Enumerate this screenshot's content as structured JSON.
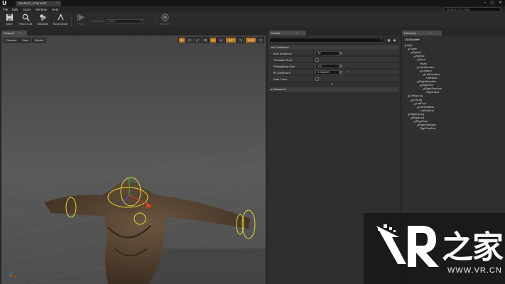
{
  "window": {
    "logo": "U",
    "doc_tab": "Skeleton_Character",
    "controls": [
      "–",
      "▢",
      "✕"
    ]
  },
  "menu": {
    "items": [
      "File",
      "Edit",
      "Asset",
      "Window",
      "Help"
    ],
    "search_placeholder": "Search For Help"
  },
  "toolbar": {
    "buttons": [
      {
        "label": "Save",
        "icon": "save-icon"
      },
      {
        "label": "Find in CB",
        "icon": "find-in-browser-icon"
      },
      {
        "label": "Simulate",
        "icon": "simulate-icon"
      },
      {
        "label": "Body Mode",
        "icon": "body-mode-icon"
      },
      {
        "label": "Play",
        "icon": "play-icon"
      },
      {
        "label": "Record",
        "icon": "record-icon"
      }
    ],
    "animation_label": "Animation",
    "animation_value": "None"
  },
  "viewport": {
    "tab": "Viewport",
    "buttons": [
      "Camera",
      "View",
      "Modes"
    ],
    "tools": [
      "⊕",
      "⟳",
      "⤢",
      "⊞",
      "10",
      "∠",
      "10°",
      "⤡",
      "0.25",
      "▢"
    ]
  },
  "details": {
    "tab": "Details",
    "section": "IK Definition",
    "rows": [
      {
        "label": "Blue Iterations",
        "type": "number",
        "value": "30"
      },
      {
        "label": "Translate Root",
        "type": "check",
        "value": "✓"
      },
      {
        "label": "Retargeting Gain",
        "type": "number",
        "value": "1.0"
      },
      {
        "label": "IK Coefficient",
        "type": "number",
        "value": "0.096150"
      },
      {
        "label": "Auto Trace",
        "type": "check",
        "value": "✓"
      }
    ],
    "advanced_label": "Advanced"
  },
  "hierarchy": {
    "tab": "Hierarchy",
    "filter_label": "All Bones▾",
    "bones": [
      {
        "name": "Hips",
        "depth": 0
      },
      {
        "name": "Spine",
        "depth": 1
      },
      {
        "name": "Spine1",
        "depth": 2
      },
      {
        "name": "Spine2",
        "depth": 3
      },
      {
        "name": "Neck",
        "depth": 4
      },
      {
        "name": "Head",
        "depth": 5
      },
      {
        "name": "LeftShoulder",
        "depth": 4
      },
      {
        "name": "LeftArm",
        "depth": 5
      },
      {
        "name": "LeftForeArm",
        "depth": 6
      },
      {
        "name": "LeftHand",
        "depth": 7
      },
      {
        "name": "RightShoulder",
        "depth": 4
      },
      {
        "name": "RightArm",
        "depth": 5
      },
      {
        "name": "RightForeArm",
        "depth": 6
      },
      {
        "name": "RightHand",
        "depth": 7
      },
      {
        "name": "LeftUpLeg",
        "depth": 1
      },
      {
        "name": "LeftLeg",
        "depth": 2
      },
      {
        "name": "LeftFoot",
        "depth": 3
      },
      {
        "name": "LeftToeBase",
        "depth": 4
      },
      {
        "name": "LeftToeEnd",
        "depth": 5
      },
      {
        "name": "RightUpLeg",
        "depth": 1
      },
      {
        "name": "RightLeg",
        "depth": 2
      },
      {
        "name": "RightFoot",
        "depth": 3
      },
      {
        "name": "RightToeBase",
        "depth": 4
      },
      {
        "name": "RightToeEnd",
        "depth": 5
      }
    ]
  },
  "watermark": {
    "brand_cn": "之家",
    "url": "WWW.VR.CN"
  },
  "colors": {
    "accent": "#b8792a",
    "panel": "#2f2f2f",
    "viewport_bg": "#4a4a4a",
    "ik_ring": "#e6d832"
  }
}
